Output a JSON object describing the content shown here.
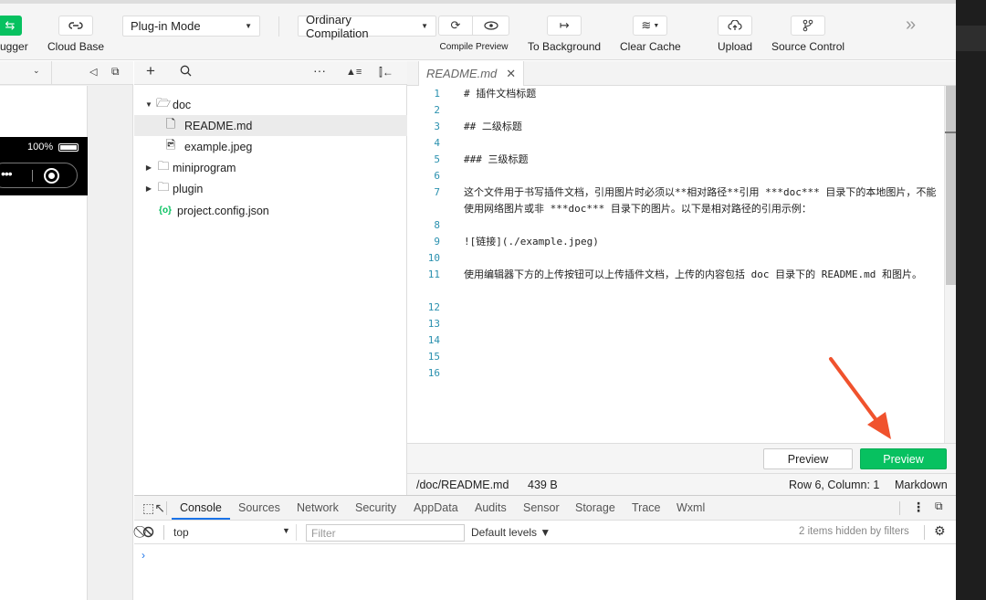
{
  "toolbar": {
    "debugger_label": "ugger",
    "cloud_base_label": "Cloud Base",
    "mode_select": "Plug-in Mode",
    "compile_select": "Ordinary Compilation",
    "compile_label": "Compile Preview",
    "to_background_label": "To Background",
    "clear_cache_label": "Clear Cache",
    "upload_label": "Upload",
    "source_control_label": "Source Control",
    "more_glyph": "»"
  },
  "simulator": {
    "battery_text": "100%",
    "dots": "•••"
  },
  "explorer": {
    "tree": [
      {
        "label": "doc",
        "type": "folder-open"
      },
      {
        "label": "README.md",
        "type": "file",
        "selected": true
      },
      {
        "label": "example.jpeg",
        "type": "image"
      },
      {
        "label": "miniprogram",
        "type": "folder"
      },
      {
        "label": "plugin",
        "type": "folder"
      },
      {
        "label": "project.config.json",
        "type": "config"
      }
    ]
  },
  "editor": {
    "tab_label": "README.md",
    "lines": [
      {
        "n": "1",
        "text": "# 插件文档标题"
      },
      {
        "n": "2",
        "text": ""
      },
      {
        "n": "3",
        "text": "## 二级标题"
      },
      {
        "n": "4",
        "text": ""
      },
      {
        "n": "5",
        "text": "### 三级标题"
      },
      {
        "n": "6",
        "text": ""
      },
      {
        "n": "7",
        "text": "这个文件用于书写插件文档，引用图片时必须以**相对路径**引用 ***doc*** 目录下的本地图片，不能使用网络图片或非 ***doc*** 目录下的图片。以下是相对路径的引用示例："
      },
      {
        "n": "8",
        "text": ""
      },
      {
        "n": "9",
        "text": "![链接](./example.jpeg)"
      },
      {
        "n": "10",
        "text": ""
      },
      {
        "n": "11",
        "text": "使用编辑器下方的上传按钮可以上传插件文档，上传的内容包括 doc 目录下的 README.md 和图片。"
      },
      {
        "n": "12",
        "text": ""
      },
      {
        "n": "13",
        "text": ""
      },
      {
        "n": "14",
        "text": ""
      },
      {
        "n": "15",
        "text": ""
      },
      {
        "n": "16",
        "text": ""
      }
    ],
    "preview_button_1": "Preview",
    "preview_button_2": "Preview",
    "status_path": "/doc/README.md",
    "status_size": "439 B",
    "status_position": "Row 6, Column: 1",
    "status_language": "Markdown"
  },
  "devtools": {
    "tabs": [
      "Console",
      "Sources",
      "Network",
      "Security",
      "AppData",
      "Audits",
      "Sensor",
      "Storage",
      "Trace",
      "Wxml"
    ],
    "active_tab": "Console",
    "context": "top",
    "filter_placeholder": "Filter",
    "levels": "Default levels ▼",
    "hidden_info": "2 items hidden by filters",
    "prompt": "›"
  },
  "colors": {
    "accent_green": "#07c160",
    "annotation_arrow": "#f0522d",
    "link_blue": "#1a73e8"
  }
}
